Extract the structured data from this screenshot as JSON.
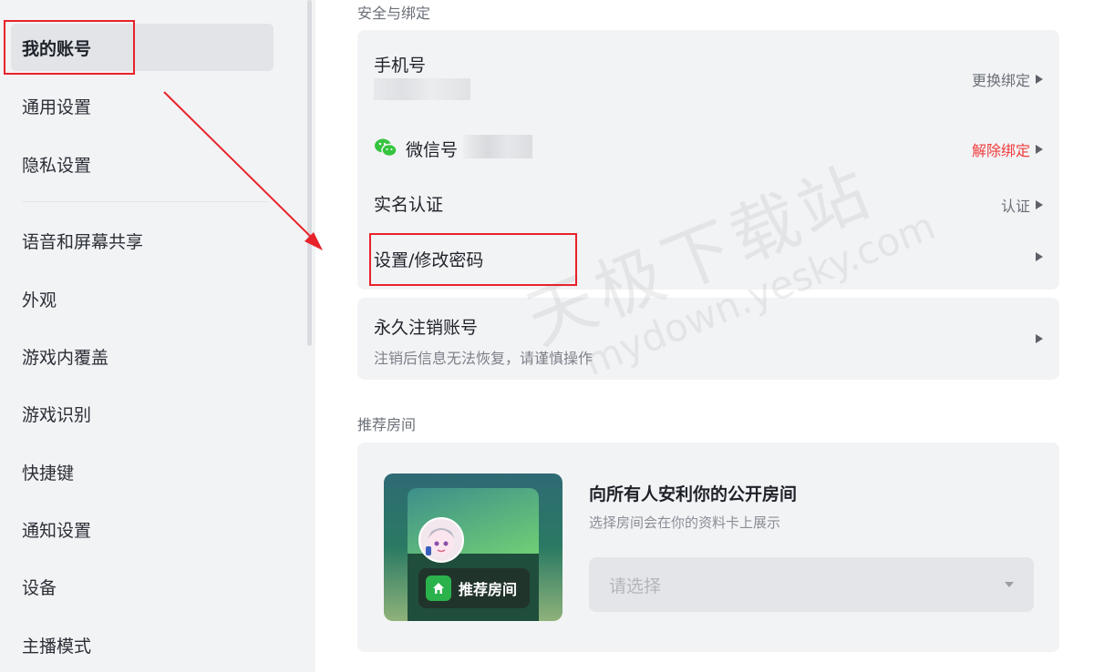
{
  "sidebar": {
    "items": [
      {
        "label": "我的账号",
        "active": true
      },
      {
        "label": "通用设置"
      },
      {
        "label": "隐私设置"
      },
      {
        "label": "语音和屏幕共享"
      },
      {
        "label": "外观"
      },
      {
        "label": "游戏内覆盖"
      },
      {
        "label": "游戏识别"
      },
      {
        "label": "快捷键"
      },
      {
        "label": "通知设置"
      },
      {
        "label": "设备"
      },
      {
        "label": "主播模式"
      }
    ]
  },
  "security": {
    "title": "安全与绑定",
    "phone_label": "手机号",
    "phone_action": "更换绑定",
    "wechat_label": "微信号",
    "wechat_action": "解除绑定",
    "realname_label": "实名认证",
    "realname_action": "认证",
    "password_label": "设置/修改密码",
    "delete_label": "永久注销账号",
    "delete_desc": "注销后信息无法恢复，请谨慎操作"
  },
  "recommend": {
    "title": "推荐房间",
    "heading": "向所有人安利你的公开房间",
    "desc": "选择房间会在你的资料卡上展示",
    "badge": "推荐房间",
    "select_placeholder": "请选择"
  },
  "watermark": {
    "cn": "天极下载站",
    "en": "mydown.yesky.com"
  },
  "colors": {
    "accent_red": "#e8222a",
    "danger": "#f23c3c",
    "wechat_green": "#35c43f"
  }
}
